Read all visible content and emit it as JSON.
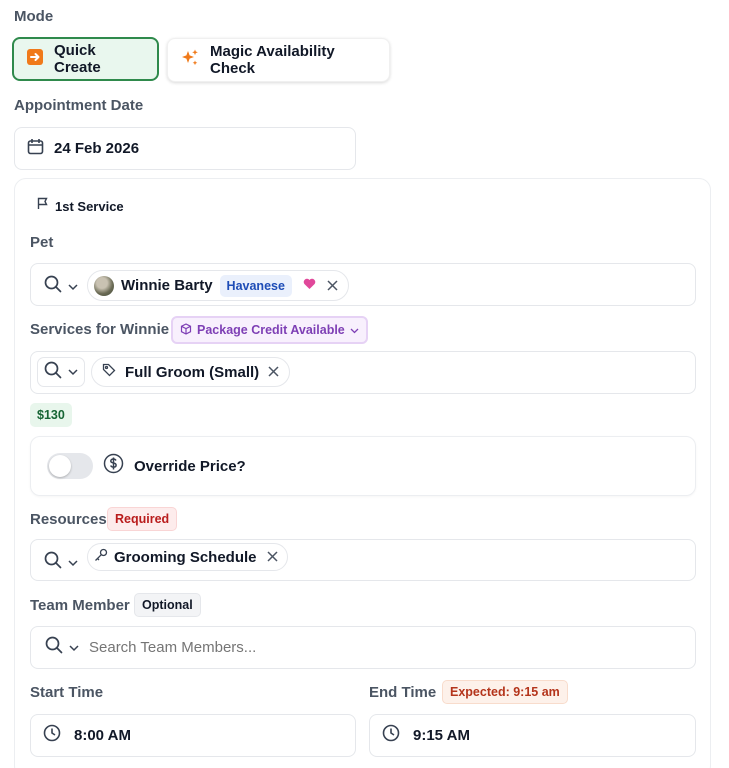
{
  "mode": {
    "label": "Mode",
    "quick_create": "Quick Create",
    "magic_check": "Magic Availability Check"
  },
  "appointment": {
    "label": "Appointment Date",
    "date": "24 Feb 2026"
  },
  "service_card": {
    "title": "1st Service",
    "pet": {
      "label": "Pet",
      "name": "Winnie Barty",
      "breed": "Havanese"
    },
    "services": {
      "label": "Services for Winnie",
      "package_badge": "Package Credit Available",
      "selected": "Full Groom (Small)",
      "price": "$130"
    },
    "override": {
      "label": "Override Price?",
      "enabled": false
    },
    "resources": {
      "label": "Resources",
      "required_badge": "Required",
      "selected": "Grooming Schedule"
    },
    "team": {
      "label": "Team Member",
      "optional_badge": "Optional",
      "placeholder": "Search Team Members..."
    },
    "start": {
      "label": "Start Time",
      "value": "8:00 AM"
    },
    "end": {
      "label": "End Time",
      "expected_badge": "Expected: 9:15 am",
      "value": "9:15 AM"
    }
  },
  "colors": {
    "quick_bg": "#e9f7ee",
    "quick_border": "#2f8a4c",
    "accent_orange": "#f07a1a",
    "package_purple": "#7e3fb5",
    "required_red": "#b91c1c",
    "price_green": "#166534",
    "heart_pink": "#e0489a",
    "breed_blue": "#1e4db7"
  }
}
